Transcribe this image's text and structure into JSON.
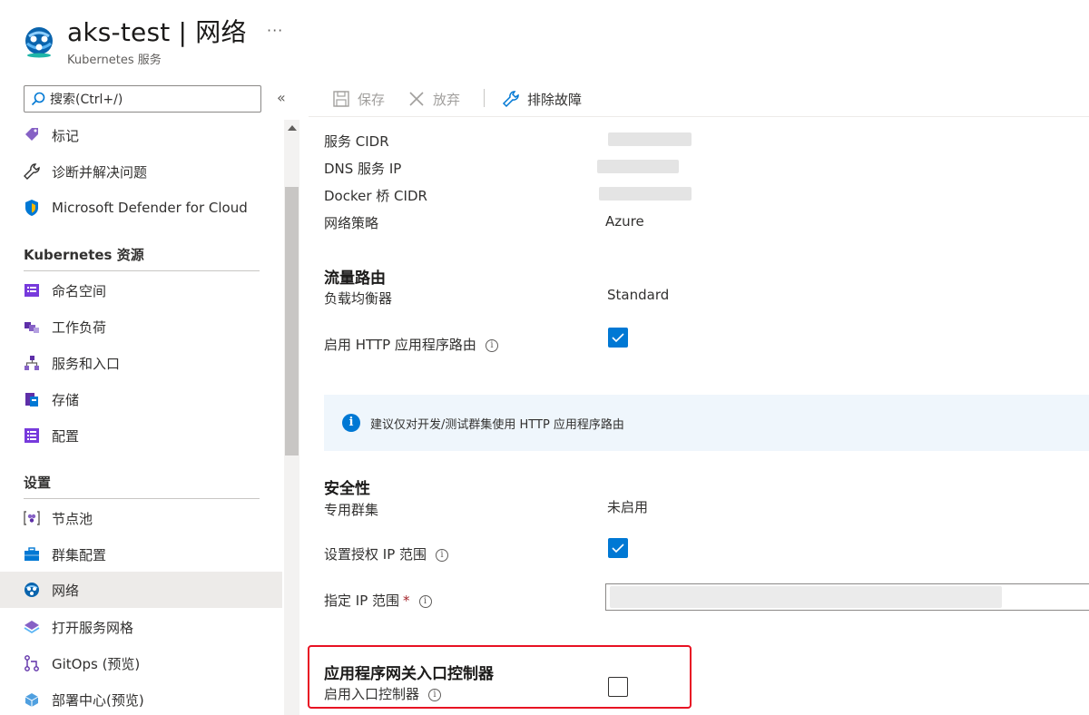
{
  "header": {
    "title": "aks-test | 网络",
    "subtitle": "Kubernetes 服务",
    "more": "···"
  },
  "sidebar": {
    "search_placeholder": "搜索(Ctrl+/)",
    "collapse": "«",
    "items": [
      {
        "label": "标记",
        "icon": "tag-icon"
      },
      {
        "label": "诊断并解决问题",
        "icon": "wrench-icon"
      },
      {
        "label": "Microsoft Defender for Cloud",
        "icon": "shield-icon"
      },
      {
        "label": "命名空间",
        "icon": "namespace-icon"
      },
      {
        "label": "工作负荷",
        "icon": "workloads-icon"
      },
      {
        "label": "服务和入口",
        "icon": "services-icon"
      },
      {
        "label": "存储",
        "icon": "storage-icon"
      },
      {
        "label": "配置",
        "icon": "configuration-icon"
      },
      {
        "label": "节点池",
        "icon": "node-pools-icon"
      },
      {
        "label": "群集配置",
        "icon": "cluster-config-icon"
      },
      {
        "label": "网络",
        "icon": "networking-icon",
        "selected": true
      },
      {
        "label": "打开服务网格",
        "icon": "service-mesh-icon"
      },
      {
        "label": "GitOps (预览)",
        "icon": "gitops-icon"
      },
      {
        "label": "部署中心(预览)",
        "icon": "deployment-center-icon"
      }
    ],
    "sections": {
      "kubernetes": "Kubernetes 资源",
      "settings": "设置"
    }
  },
  "toolbar": {
    "save": "保存",
    "discard": "放弃",
    "troubleshoot": "排除故障"
  },
  "content": {
    "service_cidr_label": "服务 CIDR",
    "dns_ip_label": "DNS 服务 IP",
    "docker_bridge_label": "Docker 桥 CIDR",
    "network_policy_label": "网络策略",
    "network_policy_value": "Azure",
    "traffic_routing": {
      "title": "流量路由",
      "lb_label": "负载均衡器",
      "lb_value": "Standard",
      "http_routing_label": "启用 HTTP 应用程序路由",
      "http_routing_checked": true,
      "info_text": "建议仅对开发/测试群集使用 HTTP 应用程序路由"
    },
    "security": {
      "title": "安全性",
      "private_cluster_label": "专用群集",
      "private_cluster_value": "未启用",
      "authorized_ip_label": "设置授权 IP 范围",
      "authorized_ip_checked": true,
      "ip_range_label": "指定 IP 范围",
      "required_mark": "*"
    },
    "agic": {
      "title": "应用程序网关入口控制器",
      "enable_label": "启用入口控制器",
      "enable_checked": false
    }
  },
  "colors": {
    "accent": "#0078d4",
    "highlight": "#e81123",
    "selected_bg": "#edebe9"
  }
}
